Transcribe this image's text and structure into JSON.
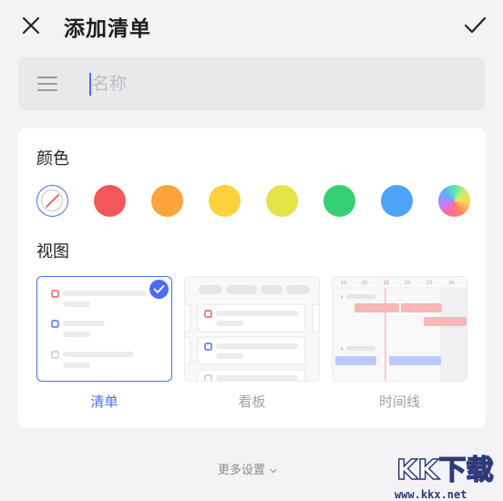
{
  "header": {
    "title": "添加清单",
    "close_icon": "close-icon",
    "confirm_icon": "check-icon"
  },
  "name_field": {
    "placeholder": "名称",
    "value": "",
    "icon": "menu-lines-icon"
  },
  "color_section": {
    "label": "颜色",
    "swatches": [
      {
        "name": "none",
        "color": "#ffffff",
        "selected": true
      },
      {
        "name": "red",
        "color": "#f4575b"
      },
      {
        "name": "orange",
        "color": "#fba43a"
      },
      {
        "name": "yellow",
        "color": "#fdd23c"
      },
      {
        "name": "lime",
        "color": "#e4e448"
      },
      {
        "name": "green",
        "color": "#36d074"
      },
      {
        "name": "blue",
        "color": "#4da4f7"
      },
      {
        "name": "rainbow",
        "color": "gradient"
      }
    ]
  },
  "view_section": {
    "label": "视图",
    "options": [
      {
        "label": "清单",
        "selected": true
      },
      {
        "label": "看板",
        "selected": false
      },
      {
        "label": "时间线",
        "selected": false
      }
    ]
  },
  "timeline_preview": {
    "days": [
      "19",
      "20",
      "21",
      "22",
      "23",
      "24"
    ]
  },
  "footer": {
    "more_settings": "更多设置"
  },
  "watermark": {
    "text": "KK下载",
    "url": "www.kkx.net"
  },
  "colors": {
    "accent": "#4a6cf7",
    "background": "#f3f3f5"
  }
}
